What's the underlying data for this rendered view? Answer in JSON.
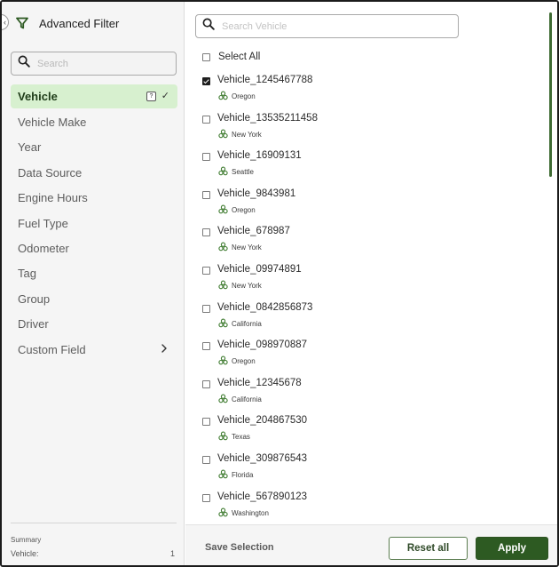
{
  "header": {
    "title": "Advanced Filter"
  },
  "left_search": {
    "placeholder": "Search"
  },
  "nav": {
    "items": [
      {
        "label": "Vehicle",
        "active": true,
        "badge": "?"
      },
      {
        "label": "Vehicle Make"
      },
      {
        "label": "Year"
      },
      {
        "label": "Data Source"
      },
      {
        "label": "Engine Hours"
      },
      {
        "label": "Fuel Type"
      },
      {
        "label": "Odometer"
      },
      {
        "label": "Tag"
      },
      {
        "label": "Group"
      },
      {
        "label": "Driver"
      },
      {
        "label": "Custom Field",
        "has_submenu": true
      }
    ]
  },
  "summary": {
    "title": "Summary",
    "label": "Vehicle:",
    "count": "1"
  },
  "right_search": {
    "placeholder": "Search Vehicle"
  },
  "select_all": {
    "label": "Select All",
    "checked": false
  },
  "vehicles": [
    {
      "name": "Vehicle_1245467788",
      "location": "Oregon",
      "checked": true
    },
    {
      "name": "Vehicle_13535211458",
      "location": "New York",
      "checked": false
    },
    {
      "name": "Vehicle_16909131",
      "location": "Seattle",
      "checked": false
    },
    {
      "name": "Vehicle_9843981",
      "location": "Oregon",
      "checked": false
    },
    {
      "name": "Vehicle_678987",
      "location": "New York",
      "checked": false
    },
    {
      "name": "Vehicle_09974891",
      "location": "New York",
      "checked": false
    },
    {
      "name": "Vehicle_0842856873",
      "location": "California",
      "checked": false
    },
    {
      "name": "Vehicle_098970887",
      "location": "Oregon",
      "checked": false
    },
    {
      "name": "Vehicle_12345678",
      "location": "California",
      "checked": false
    },
    {
      "name": "Vehicle_204867530",
      "location": "Texas",
      "checked": false
    },
    {
      "name": "Vehicle_309876543",
      "location": "Florida",
      "checked": false
    },
    {
      "name": "Vehicle_567890123",
      "location": "Washington",
      "checked": false
    }
  ],
  "footer": {
    "save_label": "Save Selection",
    "reset_label": "Reset all",
    "apply_label": "Apply"
  },
  "colors": {
    "accent": "#2d5a22",
    "active_bg": "#d7f0cf",
    "icon_green": "#3d7a2e"
  },
  "icons": {
    "filter": "filter-funnel-icon",
    "search": "search-icon",
    "location": "group-nodes-icon",
    "chevron": "chevron-right-icon",
    "check": "check-icon"
  }
}
